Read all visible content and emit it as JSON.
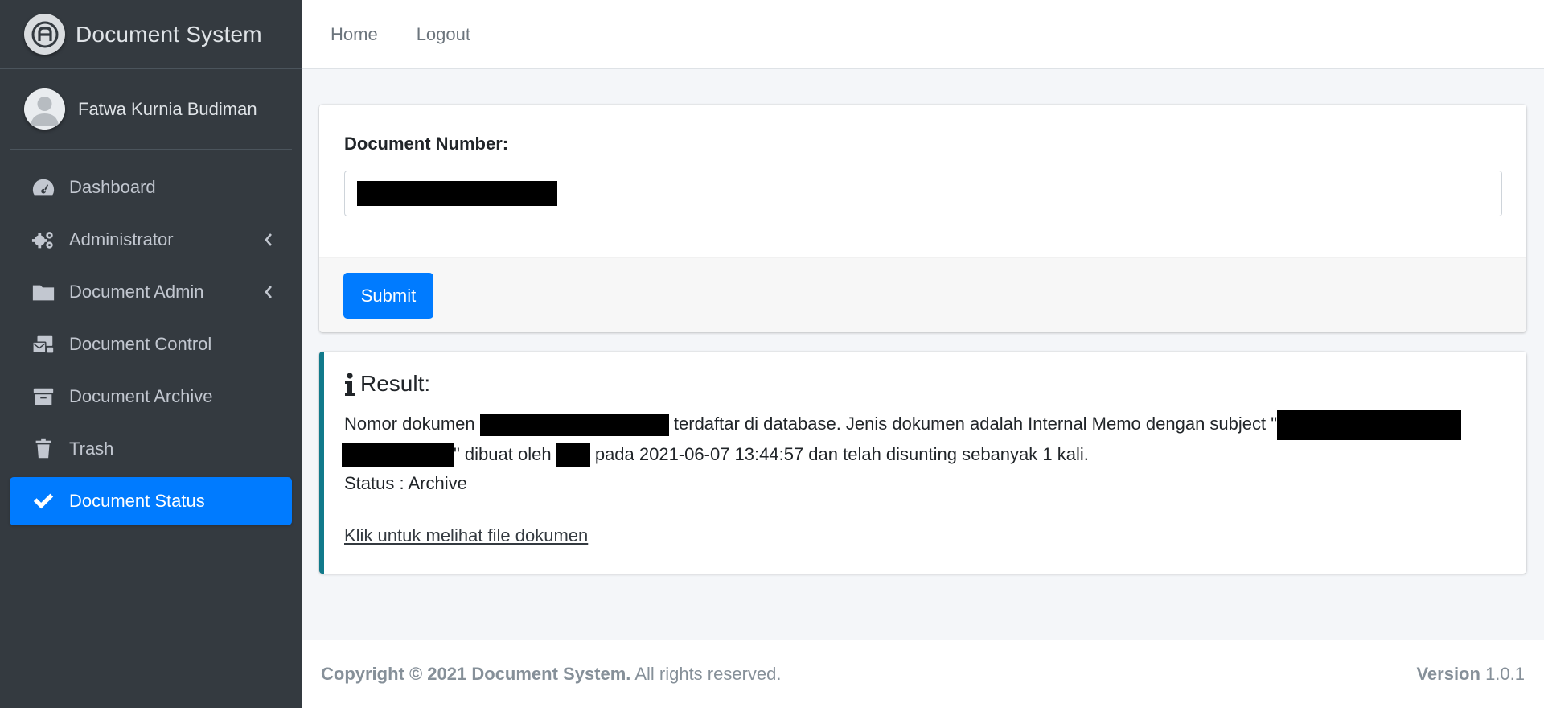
{
  "brand": {
    "title": "Document System"
  },
  "user": {
    "name": "Fatwa Kurnia Budiman"
  },
  "sidebar": {
    "items": [
      {
        "label": "Dashboard",
        "icon": "tachometer-icon"
      },
      {
        "label": "Administrator",
        "icon": "cogs-icon"
      },
      {
        "label": "Document Admin",
        "icon": "folder-icon"
      },
      {
        "label": "Document Control",
        "icon": "mail-bulk-icon"
      },
      {
        "label": "Document Archive",
        "icon": "archive-icon"
      },
      {
        "label": "Trash",
        "icon": "trash-icon"
      },
      {
        "label": "Document Status",
        "icon": "check-icon",
        "active": true
      }
    ]
  },
  "topnav": {
    "home": "Home",
    "logout": "Logout"
  },
  "form": {
    "label": "Document Number:",
    "submit": "Submit"
  },
  "result": {
    "title": "Result:",
    "text_1": "Nomor dokumen",
    "text_2": "terdaftar di database. Jenis dokumen adalah Internal Memo dengan subject \"",
    "text_3": "\" dibuat oleh",
    "text_4": "pada 2021-06-07 13:44:57 dan telah disunting sebanyak 1 kali.",
    "status": "Status : Archive",
    "link": "Klik untuk melihat file dokumen"
  },
  "footer": {
    "copyright_bold": "Copyright © 2021 Document System.",
    "copyright_rest": "All rights reserved.",
    "version_label": "Version",
    "version_value": "1.0.1"
  },
  "colors": {
    "sidebar": "#343a40",
    "accent": "#007bff",
    "callout_border": "#117a8b"
  }
}
